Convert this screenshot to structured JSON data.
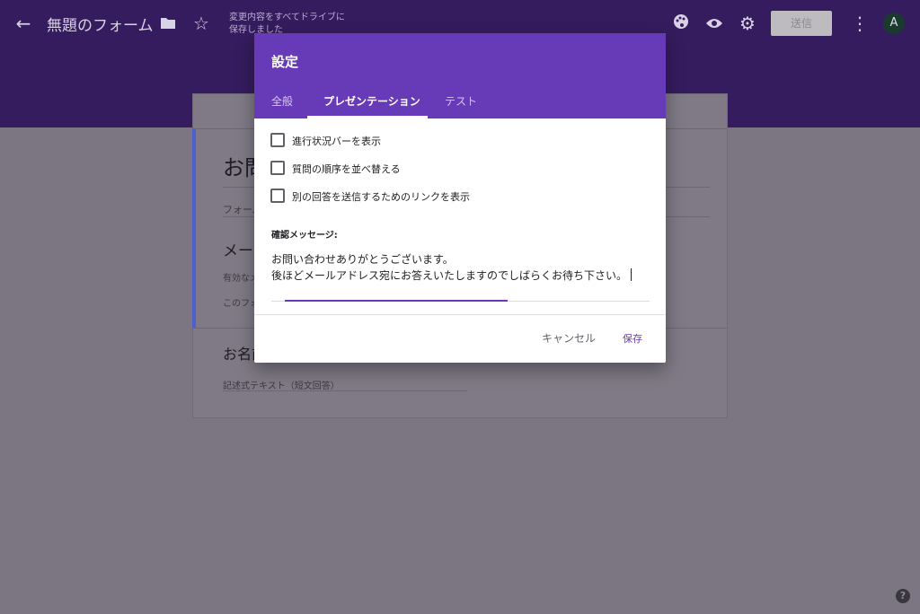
{
  "app": {
    "form_title": "無題のフォーム",
    "save_status_line1": "変更内容をすべてドライブに",
    "save_status_line2": "保存しました",
    "send_label": "送信",
    "avatar_initial": "A",
    "help_label": "?"
  },
  "background_form": {
    "title_partial": "お問",
    "description_partial": "フォーム",
    "question1_partial": "メール",
    "question1_hint_partial": "有効なメ",
    "question1_note_partial": "このフォ",
    "question2_partial": "お名前",
    "question2_answer_placeholder": "記述式テキスト（短文回答）"
  },
  "dialog": {
    "title": "設定",
    "tabs": [
      "全般",
      "プレゼンテーション",
      "テスト"
    ],
    "active_tab": "プレゼンテーション",
    "options": [
      {
        "label": "進行状況バーを表示",
        "checked": false
      },
      {
        "label": "質問の順序を並べ替える",
        "checked": false
      },
      {
        "label": "別の回答を送信するためのリンクを表示",
        "checked": false
      }
    ],
    "confirmation_label": "確認メッセージ:",
    "confirmation_line1": "お問い合わせありがとうございます。",
    "confirmation_line2": "後ほどメールアドレス宛にお答えいたしますのでしばらくお待ち下さい。",
    "cancel_label": "キャンセル",
    "save_label": "保存"
  },
  "colors": {
    "header": "#351c5e",
    "dialog_accent": "#673ab7",
    "overlay": "#7b7682"
  }
}
